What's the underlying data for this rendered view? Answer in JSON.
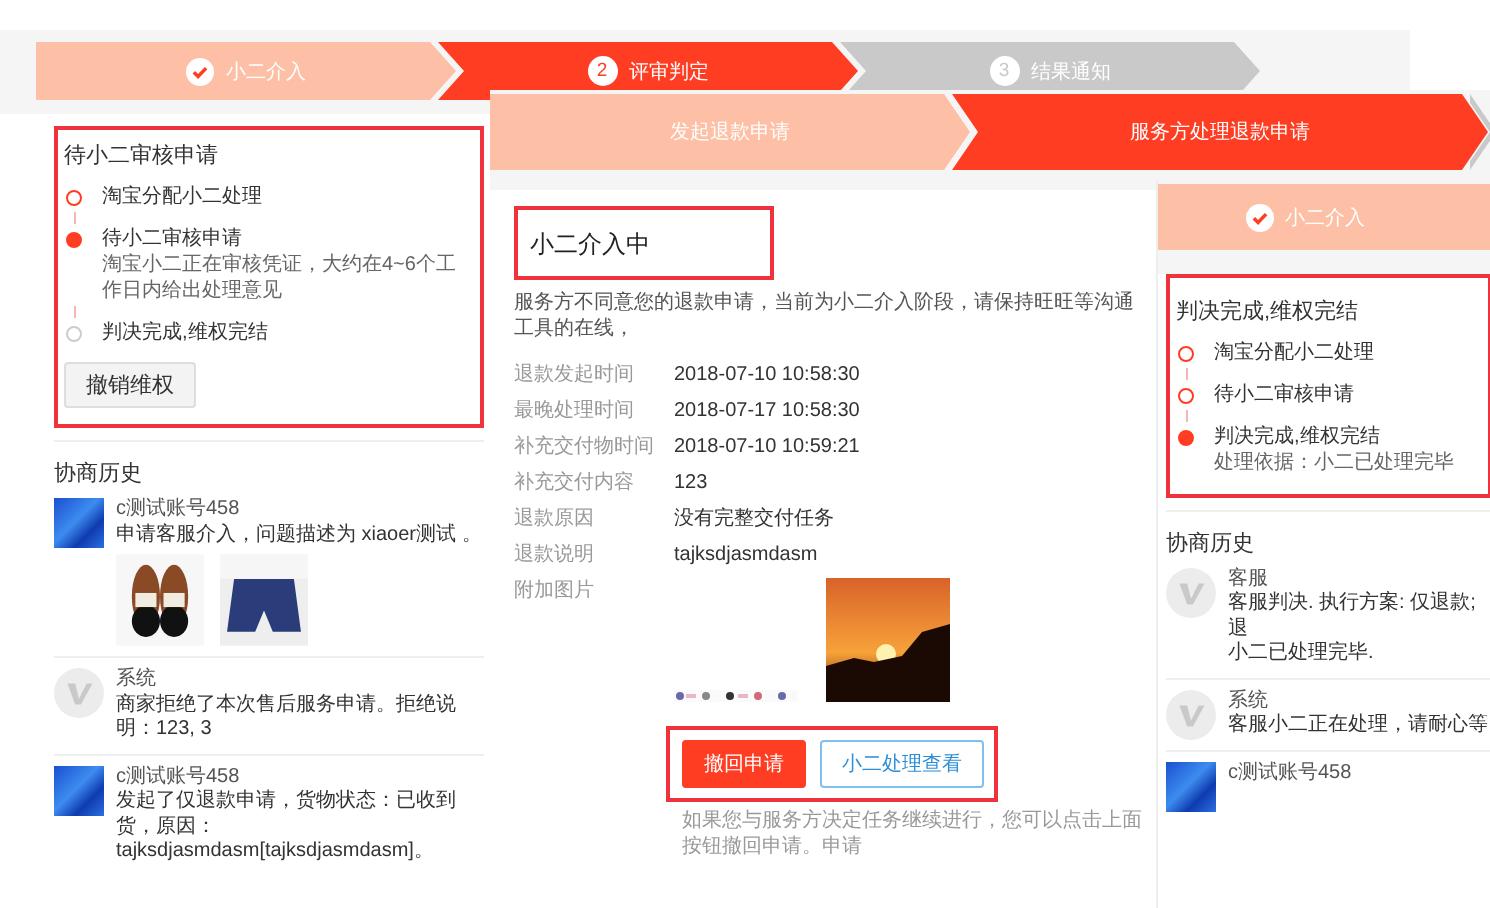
{
  "screens": [
    {
      "kind": "dispute",
      "steps": [
        {
          "label": "小二介入",
          "color": "#fdc0a6",
          "checkmark": true
        },
        {
          "label": "评审判定",
          "number": "2",
          "color": "#ff3d23",
          "checkmark": false
        },
        {
          "label": "结果通知",
          "number": "3",
          "color": "#c9c9c9",
          "checkmark": false
        }
      ],
      "status_box": {
        "highlighted": true,
        "title": "待小二审核申请",
        "timeline": [
          {
            "label": "淘宝分配小二处理",
            "color": "#ff3d23",
            "filled": false
          },
          {
            "label": "待小二审核申请",
            "note": "淘宝小二正在审核凭证，大约在4~6个工作日内给出处理意见",
            "color": "#ff3d23",
            "filled": true
          },
          {
            "label": "判决完成,维权完结",
            "color": "#cccccc",
            "filled": false
          }
        ],
        "button": "撤销维权"
      },
      "history": {
        "title": "协商历史",
        "entries": [
          {
            "author": "c测试账号458",
            "kind": "photo",
            "lines": [
              "申请客服介入，问题描述为 xiaoer测试 。"
            ],
            "attachments": [
              {
                "kind": "shoes"
              },
              {
                "kind": "shorts"
              }
            ]
          },
          {
            "author": "系统",
            "kind": "logo",
            "lines": [
              "商家拒绝了本次售后服务申请。拒绝说明：123, 3"
            ]
          },
          {
            "author": "c测试账号458",
            "kind": "photo",
            "lines": [
              "发起了仅退款申请，货物状态：已收到货，原因：",
              "tajksdjasmdasm[tajksdjasmdasm]。"
            ]
          }
        ]
      }
    },
    {
      "kind": "refund",
      "steps": [
        {
          "label": "发起退款申请",
          "color": "#fdc0a6",
          "checkmark": false
        },
        {
          "label": "服务方处理退款申请",
          "color": "#ff3d23",
          "checkmark": false
        },
        {
          "color": "#c9c9c9",
          "checkmark": false
        }
      ],
      "detail": {
        "heading": "小二介入中",
        "heading_highlighted": true,
        "description": "服务方不同意您的退款申请，当前为小二介入阶段，请保持旺旺等沟通工具的在线，",
        "fields": [
          {
            "label": "退款发起时间",
            "value": "2018-07-10 10:58:30"
          },
          {
            "label": "最晚处理时间",
            "value": "2018-07-17 10:58:30"
          },
          {
            "label": "补充交付物时间",
            "value": "2018-07-10 10:59:21"
          },
          {
            "label": "补充交付内容",
            "value": "123"
          },
          {
            "label": "退款原因",
            "value": "没有完整交付任务"
          },
          {
            "label": "退款说明",
            "value": "tajksdjasmdasm"
          }
        ],
        "attachments_label": "附加图片",
        "attachments": [
          {
            "kind": "thumbnails"
          },
          {
            "kind": "sunset"
          }
        ],
        "actions_highlighted": true,
        "buttons": [
          {
            "label": "撤回申请",
            "kind": "primary"
          },
          {
            "label": "小二处理查看",
            "kind": "secondary"
          }
        ],
        "note": "如果您与服务方决定任务继续进行，您可以点击上面按钮撤回申请。申请"
      }
    },
    {
      "kind": "verdict",
      "steps": [
        {
          "label": "小二介入",
          "color": "#fdc0a6",
          "checkmark": true
        }
      ],
      "status_box": {
        "highlighted": true,
        "title": "判决完成,维权完结",
        "timeline": [
          {
            "label": "淘宝分配小二处理",
            "color": "#ff3d23",
            "filled": false
          },
          {
            "label": "待小二审核申请",
            "color": "#ff3d23",
            "filled": false
          },
          {
            "label": "判决完成,维权完结",
            "note": "处理依据：小二已处理完毕",
            "color": "#ff3d23",
            "filled": true
          }
        ]
      },
      "history": {
        "title": "协商历史",
        "entries": [
          {
            "author": "客服",
            "kind": "logo",
            "lines": [
              "客服判决. 执行方案: 仅退款; 退",
              "小二已处理完毕."
            ]
          },
          {
            "author": "系统",
            "kind": "logo",
            "lines": [
              "客服小二正在处理，请耐心等"
            ]
          },
          {
            "author": "c测试账号458",
            "kind": "photo"
          }
        ]
      }
    }
  ]
}
